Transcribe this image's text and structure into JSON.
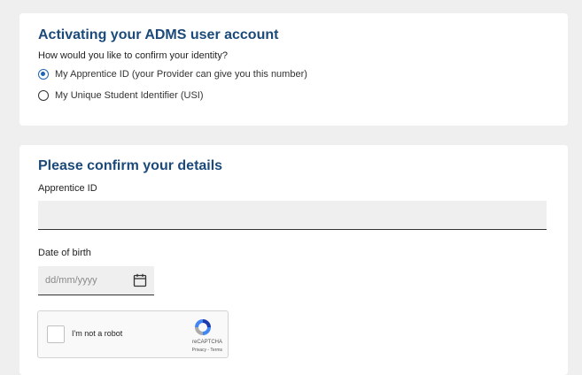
{
  "identity_card": {
    "title": "Activating your ADMS user account",
    "question": "How would you like to confirm your identity?",
    "options": [
      {
        "label": "My Apprentice ID (your Provider can give you this number)",
        "selected": true
      },
      {
        "label": "My Unique Student Identifier (USI)",
        "selected": false
      }
    ]
  },
  "details_card": {
    "title": "Please confirm your details",
    "apprentice_id": {
      "label": "Apprentice ID",
      "value": ""
    },
    "dob": {
      "label": "Date of birth",
      "placeholder": "dd/mm/yyyy",
      "icon": "calendar-icon"
    }
  },
  "recaptcha": {
    "label": "I'm not a robot",
    "brand": "reCAPTCHA",
    "links": "Privacy - Terms"
  },
  "colors": {
    "heading": "#1b4a7a",
    "accent": "#1f65b5",
    "page_bg": "#efefef",
    "input_bg": "#efefef"
  }
}
